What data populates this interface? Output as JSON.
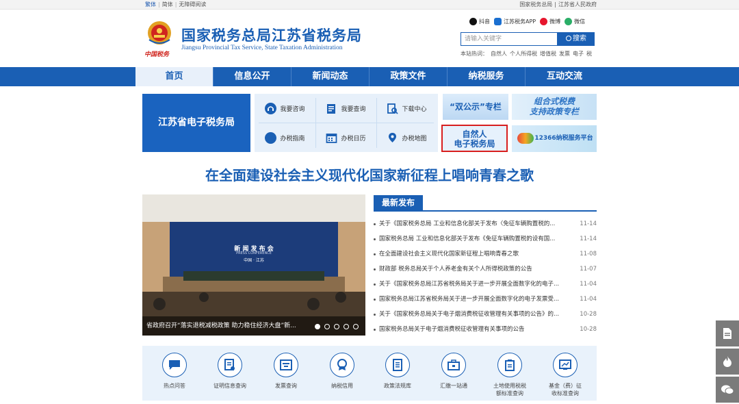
{
  "topbar": {
    "left": [
      "繁体",
      "简体",
      "无障碍阅读"
    ],
    "right": [
      "国家税务总局",
      "江苏省人民政府"
    ]
  },
  "header": {
    "title": "国家税务总局江苏省税务局",
    "subtitle": "Jiangsu Provincial Tax Service, State Taxation Administration",
    "emblem_text": "中国税务",
    "social": [
      "抖音",
      "江苏税务APP",
      "微博",
      "微信"
    ],
    "search_placeholder": "请输入关键字",
    "search_button": "搜索",
    "hot_label": "本站热词：",
    "hot_words": [
      "自然人",
      "个人所得税",
      "增值税",
      "发票",
      "电子",
      "税"
    ]
  },
  "nav": [
    "首页",
    "信息公开",
    "新闻动态",
    "政策文件",
    "纳税服务",
    "互动交流"
  ],
  "etax_title": "江苏省电子税务局",
  "services": [
    "我要咨询",
    "我要查询",
    "下载中心",
    "办税指南",
    "办税日历",
    "办税地图"
  ],
  "tiles": {
    "shuanggongshi": "“双公示”专栏",
    "zuhe_line1": "组合式税费",
    "zuhe_line2": "支持政策专栏",
    "ziranren_line1": "自然人",
    "ziranren_line2": "电子税务局",
    "service12366": "12366纳税服务平台"
  },
  "headline": "在全面建设社会主义现代化国家新征程上唱响青春之歌",
  "photo": {
    "caption": "省政府召开“落实退税减税政策 助力稳住经济大盘”新...",
    "backdrop_line1": "新 闻 发 布 会",
    "backdrop_line2": "PRESS   CONFERENCE",
    "backdrop_line3": "中国 · 江苏"
  },
  "latest": {
    "tab": "最新发布",
    "items": [
      {
        "title": "关于《国家税务总局 工业和信息化部关于发布〈免征车辆购置税的...",
        "date": "11-14"
      },
      {
        "title": "国家税务总局 工业和信息化部关于发布《免征车辆购置税的设有国...",
        "date": "11-14"
      },
      {
        "title": "在全面建设社会主义现代化国家新征程上唱响青春之歌",
        "date": "11-08"
      },
      {
        "title": "财政部 税务总局关于个人养老金有关个人所得税政策的公告",
        "date": "11-07"
      },
      {
        "title": "关于《国家税务总局江苏省税务局关于进一步开展全面数字化的电子...",
        "date": "11-04"
      },
      {
        "title": "国家税务总局江苏省税务局关于进一步开展全面数字化的电子发票受...",
        "date": "11-04"
      },
      {
        "title": "关于《国家税务总局关于电子烟消费税征收管理有关事项的公告》的...",
        "date": "10-28"
      },
      {
        "title": "国家税务总局关于电子烟消费税征收管理有关事项的公告",
        "date": "10-28"
      }
    ]
  },
  "bottom_services": [
    {
      "line1": "热点问答",
      "line2": ""
    },
    {
      "line1": "证明信息查询",
      "line2": ""
    },
    {
      "line1": "发票查询",
      "line2": ""
    },
    {
      "line1": "纳税信用",
      "line2": ""
    },
    {
      "line1": "政策法规库",
      "line2": ""
    },
    {
      "line1": "汇缴一站通",
      "line2": ""
    },
    {
      "line1": "土地使用税税",
      "line2": "额标准查询"
    },
    {
      "line1": "基金（费）征",
      "line2": "收标准查询"
    }
  ],
  "colors": {
    "brand": "#1a5fb4",
    "highlight_border": "#d81e1e"
  }
}
